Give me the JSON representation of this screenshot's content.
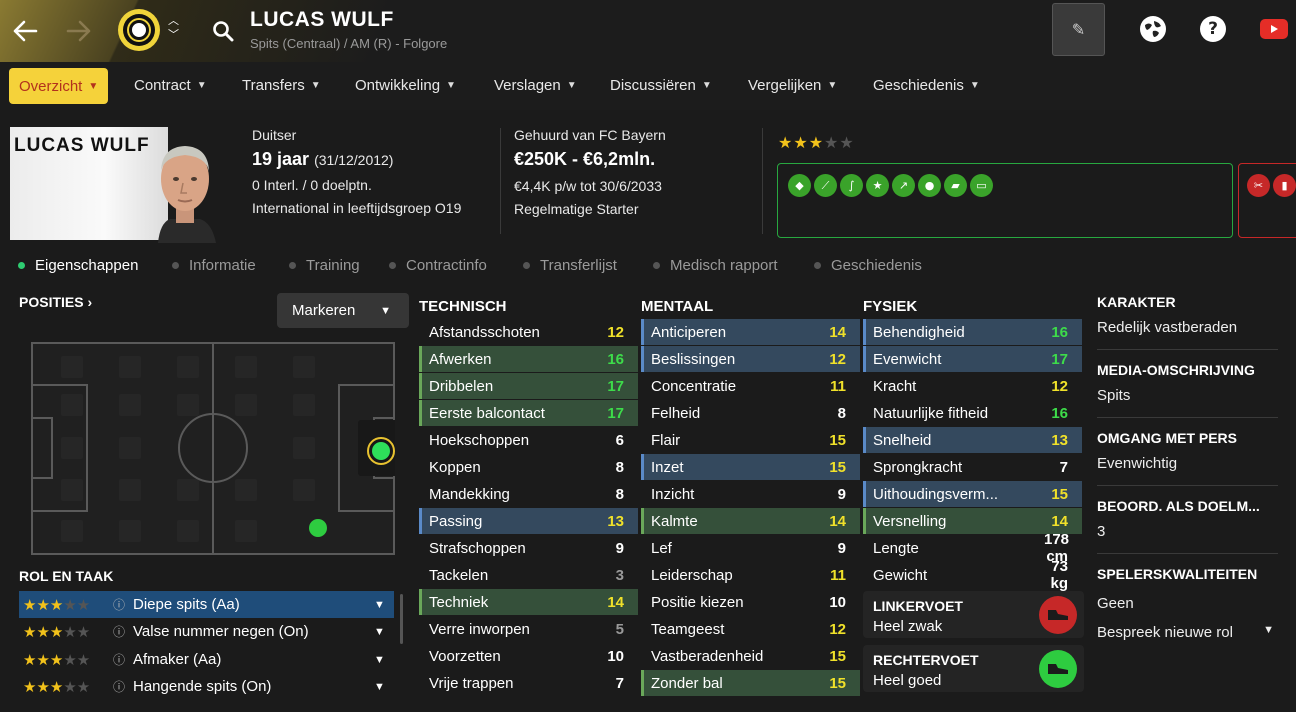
{
  "topbar": {
    "player_name": "LUCAS WULF",
    "player_subtitle": "Spits (Centraal) / AM (R) - Folgore",
    "edit_icon": "pencil-icon",
    "globe_icon": "globe-icon",
    "help_label": "?",
    "youtube_icon": "youtube-icon"
  },
  "nav": {
    "items": [
      {
        "label": "Overzicht",
        "active": true
      },
      {
        "label": "Contract"
      },
      {
        "label": "Transfers"
      },
      {
        "label": "Ontwikkeling"
      },
      {
        "label": "Verslagen"
      },
      {
        "label": "Discussiëren"
      },
      {
        "label": "Vergelijken"
      },
      {
        "label": "Geschiedenis"
      }
    ]
  },
  "header": {
    "photo_name": "LUCAS WULF",
    "nationality": "Duitser",
    "age": "19 jaar",
    "dob": "(31/12/2012)",
    "caps": "0 Interl. / 0 doelptn.",
    "youth_intl": "International in leeftijdsgroep O19",
    "loan_from": "Gehuurd van FC Bayern",
    "value": "€250K - €6,2mln.",
    "wage": "€4,4K p/w tot 30/6/2033",
    "squad_status": "Regelmatige Starter",
    "star_rating": 3,
    "star_max": 5,
    "traits": [
      "tag-icon",
      "boot-icon",
      "dribble-icon",
      "star-icon",
      "trend-icon",
      "head-icon",
      "handshake-icon",
      "pitch-icon"
    ],
    "negative_traits": [
      "injury-icon",
      "card-icon"
    ]
  },
  "subtabs": [
    "Eigenschappen",
    "Informatie",
    "Training",
    "Contractinfo",
    "Transferlijst",
    "Medisch rapport",
    "Geschiedenis"
  ],
  "positions": {
    "heading": "POSITIES",
    "mark_button": "Markeren"
  },
  "roles": {
    "heading": "ROL EN TAAK",
    "items": [
      {
        "name": "Diepe spits (Aa)",
        "stars": 3,
        "selected": true
      },
      {
        "name": "Valse nummer negen (On)",
        "stars": 3
      },
      {
        "name": "Afmaker (Aa)",
        "stars": 3
      },
      {
        "name": "Hangende spits (On)",
        "stars": 3
      }
    ]
  },
  "technical": {
    "heading": "TECHNISCH",
    "attrs": [
      {
        "name": "Afstandsschoten",
        "value": "12",
        "hl": ""
      },
      {
        "name": "Afwerken",
        "value": "16",
        "hl": "green"
      },
      {
        "name": "Dribbelen",
        "value": "17",
        "hl": "green"
      },
      {
        "name": "Eerste balcontact",
        "value": "17",
        "hl": "green"
      },
      {
        "name": "Hoekschoppen",
        "value": "6",
        "hl": ""
      },
      {
        "name": "Koppen",
        "value": "8",
        "hl": ""
      },
      {
        "name": "Mandekking",
        "value": "8",
        "hl": ""
      },
      {
        "name": "Passing",
        "value": "13",
        "hl": "blue"
      },
      {
        "name": "Strafschoppen",
        "value": "9",
        "hl": ""
      },
      {
        "name": "Tackelen",
        "value": "3",
        "hl": ""
      },
      {
        "name": "Techniek",
        "value": "14",
        "hl": "green"
      },
      {
        "name": "Verre inworpen",
        "value": "5",
        "hl": ""
      },
      {
        "name": "Voorzetten",
        "value": "10",
        "hl": ""
      },
      {
        "name": "Vrije trappen",
        "value": "7",
        "hl": ""
      }
    ]
  },
  "mental": {
    "heading": "MENTAAL",
    "attrs": [
      {
        "name": "Anticiperen",
        "value": "14",
        "hl": "blue"
      },
      {
        "name": "Beslissingen",
        "value": "12",
        "hl": "blue"
      },
      {
        "name": "Concentratie",
        "value": "11",
        "hl": ""
      },
      {
        "name": "Felheid",
        "value": "8",
        "hl": ""
      },
      {
        "name": "Flair",
        "value": "15",
        "hl": ""
      },
      {
        "name": "Inzet",
        "value": "15",
        "hl": "blue"
      },
      {
        "name": "Inzicht",
        "value": "9",
        "hl": ""
      },
      {
        "name": "Kalmte",
        "value": "14",
        "hl": "green"
      },
      {
        "name": "Lef",
        "value": "9",
        "hl": ""
      },
      {
        "name": "Leiderschap",
        "value": "11",
        "hl": ""
      },
      {
        "name": "Positie kiezen",
        "value": "10",
        "hl": ""
      },
      {
        "name": "Teamgeest",
        "value": "12",
        "hl": ""
      },
      {
        "name": "Vastberadenheid",
        "value": "15",
        "hl": ""
      },
      {
        "name": "Zonder bal",
        "value": "15",
        "hl": "green"
      }
    ]
  },
  "physical": {
    "heading": "FYSIEK",
    "attrs": [
      {
        "name": "Behendigheid",
        "value": "16",
        "hl": "blue"
      },
      {
        "name": "Evenwicht",
        "value": "17",
        "hl": "blue"
      },
      {
        "name": "Kracht",
        "value": "12",
        "hl": ""
      },
      {
        "name": "Natuurlijke fitheid",
        "value": "16",
        "hl": ""
      },
      {
        "name": "Snelheid",
        "value": "13",
        "hl": "blue"
      },
      {
        "name": "Sprongkracht",
        "value": "7",
        "hl": ""
      },
      {
        "name": "Uithoudingsverm...",
        "value": "15",
        "hl": "blue"
      },
      {
        "name": "Versnelling",
        "value": "14",
        "hl": "green"
      },
      {
        "name": "Lengte",
        "value": "178 cm",
        "hl": ""
      },
      {
        "name": "Gewicht",
        "value": "73 kg",
        "hl": ""
      }
    ],
    "left_foot_label": "LINKERVOET",
    "left_foot_value": "Heel zwak",
    "right_foot_label": "RECHTERVOET",
    "right_foot_value": "Heel goed"
  },
  "info": {
    "personality_label": "KARAKTER",
    "personality_value": "Redelijk vastberaden",
    "media_label": "MEDIA-OMSCHRIJVING",
    "media_value": "Spits",
    "press_label": "OMGANG MET PERS",
    "press_value": "Evenwichtig",
    "gk_label": "BEOORD. ALS DOELM...",
    "gk_value": "3",
    "qualities_label": "SPELERSKWALITEITEN",
    "qualities_value": "Geen",
    "discuss_label": "Bespreek nieuwe rol"
  },
  "colors": {
    "accent": "#f5d23a",
    "value_green": "#3ddc4a",
    "value_yellow": "#f0e12a",
    "value_white": "#ffffff",
    "value_grey": "#9a9a9a"
  }
}
